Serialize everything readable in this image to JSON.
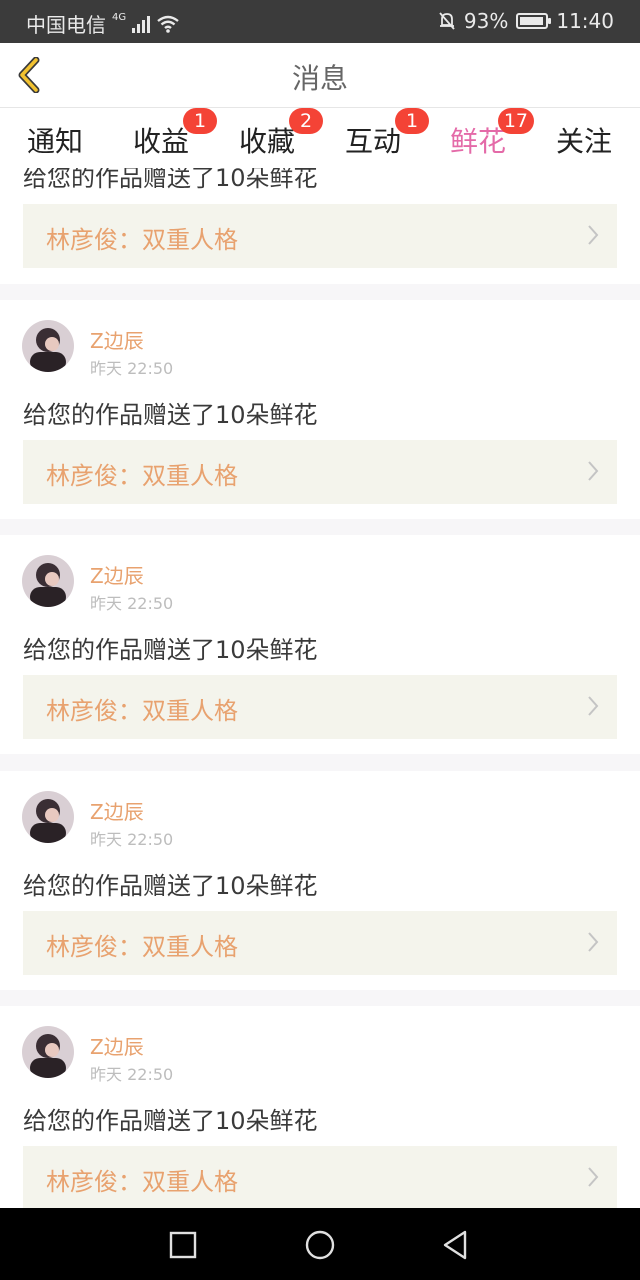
{
  "status_bar": {
    "carrier": "中国电信",
    "network": "4G",
    "battery": "93%",
    "battery_level": 0.93,
    "time": "11:40"
  },
  "header": {
    "title": "消息",
    "back_icon": "chevron-left-icon",
    "accent_color": "#f2c230"
  },
  "tabs": [
    {
      "label": "通知",
      "badge": ""
    },
    {
      "label": "收益",
      "badge": "1"
    },
    {
      "label": "收藏",
      "badge": "2"
    },
    {
      "label": "互动",
      "badge": "1"
    },
    {
      "label": "鲜花",
      "badge": "17",
      "active": true
    },
    {
      "label": "关注",
      "badge": ""
    }
  ],
  "colors": {
    "active_tab": "#e46aa8",
    "badge": "#f44336",
    "username": "#e8a26f",
    "row_bg": "#f4f4ec"
  },
  "cards": [
    {
      "partial": true,
      "message": "给您的作品赠送了10朵鲜花",
      "work_title": "林彦俊：双重人格"
    },
    {
      "username": "Z边辰",
      "time": "昨天 22:50",
      "message": "给您的作品赠送了10朵鲜花",
      "work_title": "林彦俊：双重人格"
    },
    {
      "username": "Z边辰",
      "time": "昨天 22:50",
      "message": "给您的作品赠送了10朵鲜花",
      "work_title": "林彦俊：双重人格"
    },
    {
      "username": "Z边辰",
      "time": "昨天 22:50",
      "message": "给您的作品赠送了10朵鲜花",
      "work_title": "林彦俊：双重人格"
    },
    {
      "username": "Z边辰",
      "time": "昨天 22:50",
      "message": "给您的作品赠送了10朵鲜花",
      "work_title": "林彦俊：双重人格"
    }
  ],
  "nav_bar": {
    "icons": [
      "square-recent-apps-icon",
      "circle-home-icon",
      "triangle-back-icon"
    ]
  }
}
